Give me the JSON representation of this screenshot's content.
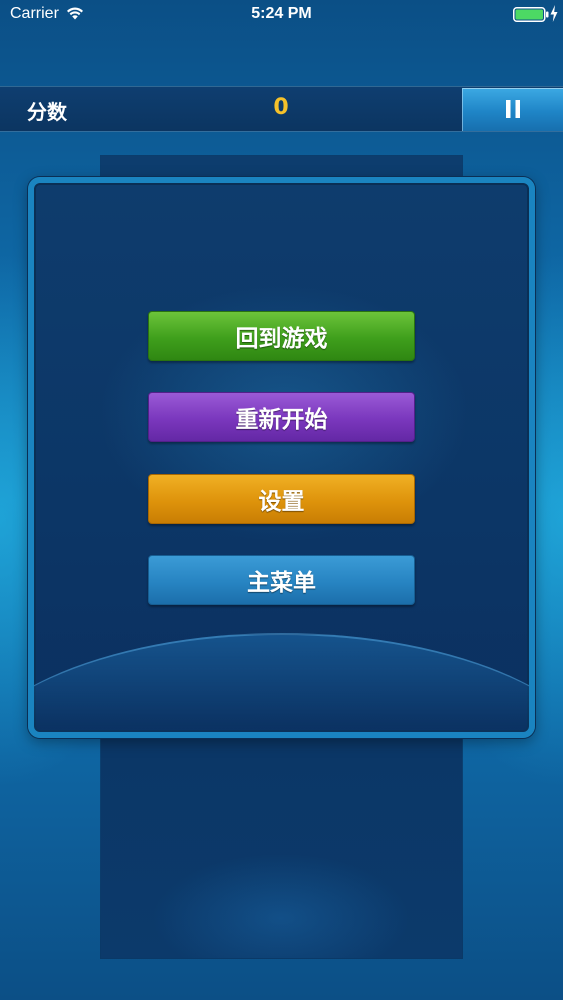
{
  "status_bar": {
    "carrier": "Carrier",
    "time": "5:24 PM",
    "wifi_icon": "wifi-icon",
    "battery_icon": "battery-full-icon",
    "charging_icon": "charging-bolt-icon"
  },
  "score_bar": {
    "label": "分数",
    "value": "0",
    "value_color": "#f5c12a",
    "pause_icon": "pause-icon"
  },
  "pause_menu": {
    "buttons": [
      {
        "label": "回到游戏",
        "color": "#3f9f1c"
      },
      {
        "label": "重新开始",
        "color": "#7a37bd"
      },
      {
        "label": "设置",
        "color": "#de930b"
      },
      {
        "label": "主菜单",
        "color": "#2784c2"
      }
    ]
  }
}
